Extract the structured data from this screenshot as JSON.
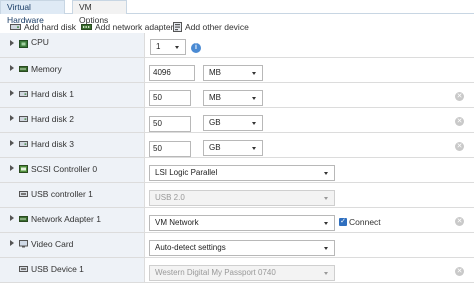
{
  "tabs": [
    {
      "label": "Virtual Hardware",
      "active": true
    },
    {
      "label": "VM Options",
      "active": false
    }
  ],
  "toolbar": {
    "add_hard_disk": "Add hard disk",
    "add_network_adapter": "Add network adapter",
    "add_other_device": "Add other device"
  },
  "rows": {
    "cpu": {
      "label": "CPU",
      "value": "1",
      "icon": "cpu-icon"
    },
    "memory": {
      "label": "Memory",
      "value": "4096",
      "unit": "MB",
      "icon": "memory-icon"
    },
    "hard_disk_1": {
      "label": "Hard disk 1",
      "value": "50",
      "unit": "MB",
      "icon": "hard-disk-icon"
    },
    "hard_disk_2": {
      "label": "Hard disk 2",
      "value": "50",
      "unit": "GB",
      "icon": "hard-disk-icon"
    },
    "hard_disk_3": {
      "label": "Hard disk 3",
      "value": "50",
      "unit": "GB",
      "icon": "hard-disk-icon"
    },
    "scsi": {
      "label": "SCSI Controller 0",
      "value": "LSI Logic Parallel",
      "icon": "scsi-controller-icon"
    },
    "usb_controller": {
      "label": "USB controller 1",
      "value": "USB 2.0",
      "icon": "usb-controller-icon"
    },
    "network_adapter": {
      "label": "Network Adapter 1",
      "value": "VM Network",
      "connect_label": "Connect",
      "connected": true,
      "icon": "network-adapter-icon"
    },
    "video_card": {
      "label": "Video Card",
      "value": "Auto-detect settings",
      "icon": "video-card-icon"
    },
    "usb_device": {
      "label": "USB Device 1",
      "value": "Western Digital My Passport 0740",
      "icon": "usb-device-icon"
    }
  },
  "icons": {
    "info": "info-icon",
    "remove": "remove-icon",
    "expand": "expand-arrow-icon"
  },
  "colors": {
    "tab_active_bg": "#dfeaf5",
    "label_bg": "#eef2f7",
    "info_blue": "#4a8ad3",
    "checkbox_blue": "#2f6fbf"
  }
}
